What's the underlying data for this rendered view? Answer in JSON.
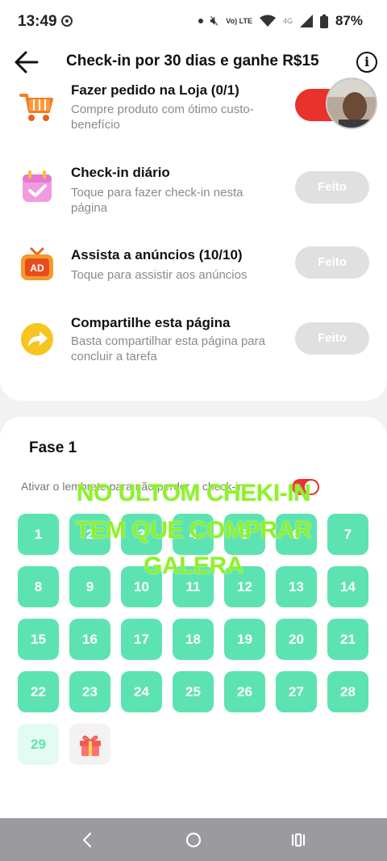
{
  "status_bar": {
    "time": "13:49",
    "volte": "Vo) LTE",
    "network": "4G",
    "battery": "87%"
  },
  "header": {
    "title": "Check-in por 30 dias e ganhe R$15"
  },
  "tasks": [
    {
      "icon": "shopping-cart-icon",
      "title": "Fazer pedido na Loja  (0/1)",
      "desc": "Compre produto com ótimo custo-benefício",
      "button": ""
    },
    {
      "icon": "calendar-check-icon",
      "title": "Check-in diário",
      "desc": "Toque para fazer check-in nesta página",
      "button": "Feito"
    },
    {
      "icon": "ad-tv-icon",
      "title": "Assista a anúncios  (10/10)",
      "desc": "Toque para assistir aos anúncios",
      "button": "Feito"
    },
    {
      "icon": "share-arrow-icon",
      "title": "Compartilhe esta página",
      "desc": "Basta compartilhar esta página para concluir a tarefa",
      "button": "Feito"
    }
  ],
  "phase": {
    "title": "Fase 1",
    "reminder_label": "Ativar o lembrete para não perder o check-in",
    "reminder_on": true,
    "days": [
      "1",
      "2",
      "3",
      "4",
      "5",
      "6",
      "7",
      "8",
      "9",
      "10",
      "11",
      "12",
      "13",
      "14",
      "15",
      "16",
      "17",
      "18",
      "19",
      "20",
      "21",
      "22",
      "23",
      "24",
      "25",
      "26",
      "27",
      "28",
      "29"
    ],
    "today": "29"
  },
  "overlay_text": {
    "line1": "NO ULTOM CHEKI-IN",
    "line2": "TEM QUE COMPRAR",
    "line3": "GALERA"
  },
  "colors": {
    "accent_green": "#5de3b1",
    "accent_red": "#e8322b",
    "overlay_green": "#8ff02e"
  }
}
